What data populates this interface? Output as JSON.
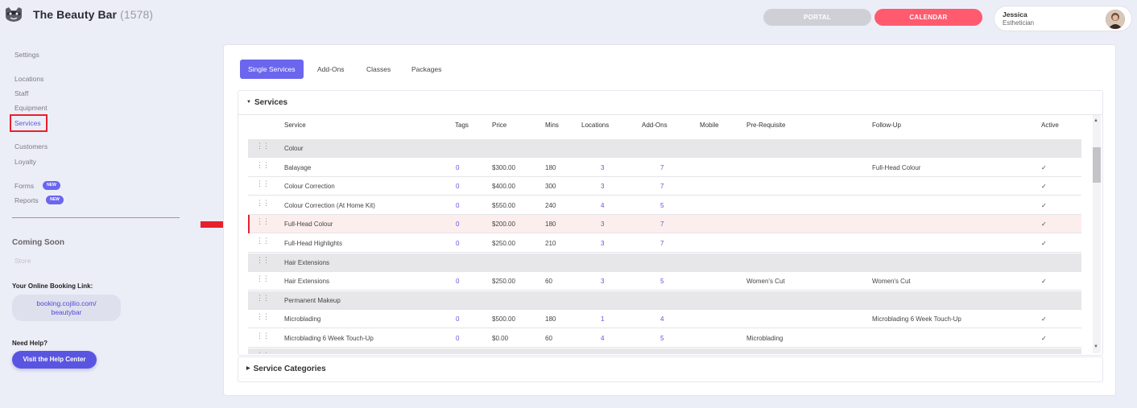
{
  "header": {
    "brand": "The Beauty Bar",
    "count": "(1578)",
    "portal_label": "PORTAL",
    "calendar_label": "CALENDAR",
    "user_name": "Jessica",
    "user_role": "Esthetician"
  },
  "sidebar": {
    "items": [
      "Settings",
      "Locations",
      "Staff",
      "Equipment",
      "Services",
      "Customers",
      "Loyalty",
      "Forms",
      "Reports"
    ],
    "badge": "NEW",
    "coming_soon": "Coming Soon",
    "store": "Store",
    "booking_label": "Your Online Booking Link:",
    "booking_link_1": "booking.cojilio.com/",
    "booking_link_2": "beautybar",
    "help_label": "Need Help?",
    "help_button": "Visit the Help Center"
  },
  "tabs": [
    "Single Services",
    "Add-Ons",
    "Classes",
    "Packages"
  ],
  "sections": {
    "services": "Services",
    "categories": "Service Categories"
  },
  "table": {
    "headers": [
      "Service",
      "Tags",
      "Price",
      "Mins",
      "Locations",
      "Add-Ons",
      "Mobile",
      "Pre-Requisite",
      "Follow-Up",
      "Active"
    ],
    "rows": [
      {
        "type": "cat",
        "name": "Colour"
      },
      {
        "type": "svc",
        "name": "Balayage",
        "tags": "0",
        "price": "$300.00",
        "mins": "180",
        "loc": "3",
        "addons": "7",
        "pre": "",
        "follow": "Full-Head Colour",
        "active": "✓"
      },
      {
        "type": "svc",
        "name": "Colour Correction",
        "tags": "0",
        "price": "$400.00",
        "mins": "300",
        "loc": "3",
        "addons": "7",
        "pre": "",
        "follow": "",
        "active": "✓"
      },
      {
        "type": "svc",
        "name": "Colour Correction (At Home Kit)",
        "tags": "0",
        "price": "$550.00",
        "mins": "240",
        "loc": "4",
        "addons": "5",
        "pre": "",
        "follow": "",
        "active": "✓"
      },
      {
        "type": "svc",
        "name": "Full-Head Colour",
        "tags": "0",
        "price": "$200.00",
        "mins": "180",
        "loc": "3",
        "addons": "7",
        "pre": "",
        "follow": "",
        "active": "✓",
        "selected": true
      },
      {
        "type": "svc",
        "name": "Full-Head Highlights",
        "tags": "0",
        "price": "$250.00",
        "mins": "210",
        "loc": "3",
        "addons": "7",
        "pre": "",
        "follow": "",
        "active": "✓"
      },
      {
        "type": "cat",
        "name": "Hair Extensions"
      },
      {
        "type": "svc",
        "name": "Hair Extensions",
        "tags": "0",
        "price": "$250.00",
        "mins": "60",
        "loc": "3",
        "addons": "5",
        "pre": "Women's Cut",
        "follow": "Women's Cut",
        "active": "✓"
      },
      {
        "type": "cat",
        "name": "Permanent Makeup"
      },
      {
        "type": "svc",
        "name": "Microblading",
        "tags": "0",
        "price": "$500.00",
        "mins": "180",
        "loc": "1",
        "addons": "4",
        "pre": "",
        "follow": "Microblading 6 Week Touch-Up",
        "active": "✓"
      },
      {
        "type": "svc",
        "name": "Microblading 6 Week Touch-Up",
        "tags": "0",
        "price": "$0.00",
        "mins": "60",
        "loc": "4",
        "addons": "5",
        "pre": "Microblading",
        "follow": "",
        "active": "✓"
      },
      {
        "type": "cat",
        "name": ""
      }
    ]
  },
  "colors": {
    "accent": "#6b66ee",
    "calendar": "#ff5a6e",
    "highlight": "#e8202d"
  }
}
